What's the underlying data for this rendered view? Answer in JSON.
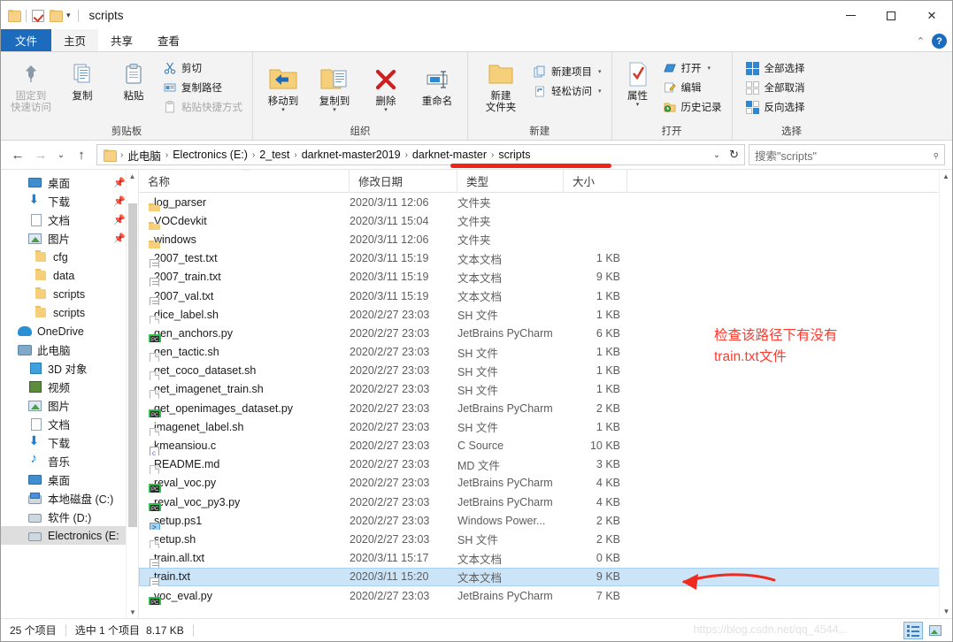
{
  "window": {
    "title": "scripts",
    "controls": {
      "minimize": "—",
      "maximize": "□",
      "close": "✕",
      "collapse_ribbon": "⌃",
      "help": "?"
    }
  },
  "ribbon": {
    "tabs": [
      {
        "id": "file",
        "label": "文件"
      },
      {
        "id": "home",
        "label": "主页"
      },
      {
        "id": "share",
        "label": "共享"
      },
      {
        "id": "view",
        "label": "查看"
      }
    ],
    "groups": [
      {
        "id": "clipboard",
        "label": "剪贴板",
        "big": [
          {
            "id": "pin-to-quick-access",
            "label": "固定到\n快速访问",
            "line1": "固定到",
            "line2": "快速访问",
            "icon": "pin-icon",
            "disabled": true
          },
          {
            "id": "copy",
            "label": "复制",
            "icon": "copy-icon"
          },
          {
            "id": "paste",
            "label": "粘贴",
            "icon": "paste-icon"
          }
        ],
        "small": [
          {
            "id": "cut",
            "label": "剪切",
            "icon": "scissors-icon"
          },
          {
            "id": "copy-path",
            "label": "复制路径",
            "icon": "copy-path-icon"
          },
          {
            "id": "paste-shortcut",
            "label": "粘贴快捷方式",
            "icon": "paste-shortcut-icon",
            "disabled": true
          }
        ]
      },
      {
        "id": "organize",
        "label": "组织",
        "big": [
          {
            "id": "move-to",
            "label": "移动到",
            "icon": "move-to-icon",
            "has_caret": true
          },
          {
            "id": "copy-to",
            "label": "复制到",
            "icon": "copy-to-icon",
            "has_caret": true
          },
          {
            "id": "delete",
            "label": "删除",
            "icon": "delete-icon",
            "has_caret": true
          },
          {
            "id": "rename",
            "label": "重命名",
            "icon": "rename-icon"
          }
        ],
        "small": []
      },
      {
        "id": "new",
        "label": "新建",
        "big": [
          {
            "id": "new-folder",
            "label": "新建\n文件夹",
            "line1": "新建",
            "line2": "文件夹",
            "icon": "new-folder-icon"
          }
        ],
        "small": [
          {
            "id": "new-item",
            "label": "新建项目",
            "icon": "new-item-icon",
            "has_caret": true
          },
          {
            "id": "easy-access",
            "label": "轻松访问",
            "icon": "easy-access-icon",
            "has_caret": true
          }
        ]
      },
      {
        "id": "open",
        "label": "打开",
        "big": [
          {
            "id": "properties",
            "label": "属性",
            "icon": "properties-icon",
            "has_caret": true
          }
        ],
        "small": [
          {
            "id": "open",
            "label": "打开",
            "icon": "open-icon",
            "has_caret": true
          },
          {
            "id": "edit",
            "label": "编辑",
            "icon": "edit-icon"
          },
          {
            "id": "history",
            "label": "历史记录",
            "icon": "history-icon"
          }
        ]
      },
      {
        "id": "select",
        "label": "选择",
        "big": [],
        "small": [
          {
            "id": "select-all",
            "label": "全部选择",
            "icon": "select-all-icon"
          },
          {
            "id": "select-none",
            "label": "全部取消",
            "icon": "select-none-icon"
          },
          {
            "id": "invert-selection",
            "label": "反向选择",
            "icon": "invert-selection-icon"
          }
        ]
      }
    ]
  },
  "navigation": {
    "back": "←",
    "forward": "→",
    "recent": "⌄",
    "up": "↑",
    "breadcrumbs": [
      "此电脑",
      "Electronics (E:)",
      "2_test",
      "darknet-master2019",
      "darknet-master",
      "scripts"
    ],
    "separator": "›",
    "dropdown": "⌄",
    "refresh": "↻",
    "search_placeholder": "搜索\"scripts\""
  },
  "sidebar": {
    "items": [
      {
        "label": "桌面",
        "icon": "desktop-icon",
        "level": 2,
        "pinned": true
      },
      {
        "label": "下载",
        "icon": "download-icon",
        "level": 2,
        "pinned": true
      },
      {
        "label": "文档",
        "icon": "documents-icon",
        "level": 2,
        "pinned": true
      },
      {
        "label": "图片",
        "icon": "pictures-icon",
        "level": 2,
        "pinned": true
      },
      {
        "label": "cfg",
        "icon": "folder-icon",
        "level": 3,
        "pinned": false
      },
      {
        "label": "data",
        "icon": "folder-icon",
        "level": 3,
        "pinned": false
      },
      {
        "label": "scripts",
        "icon": "folder-icon",
        "level": 3,
        "pinned": false
      },
      {
        "label": "scripts",
        "icon": "folder-icon",
        "level": 3,
        "pinned": false
      },
      {
        "label": "OneDrive",
        "icon": "onedrive-icon",
        "level": 1,
        "pinned": false
      },
      {
        "label": "此电脑",
        "icon": "this-pc-icon",
        "level": 1,
        "pinned": false
      },
      {
        "label": "3D 对象",
        "icon": "3d-objects-icon",
        "level": 2,
        "pinned": false
      },
      {
        "label": "视频",
        "icon": "videos-icon",
        "level": 2,
        "pinned": false
      },
      {
        "label": "图片",
        "icon": "pictures-icon",
        "level": 2,
        "pinned": false
      },
      {
        "label": "文档",
        "icon": "documents-icon",
        "level": 2,
        "pinned": false
      },
      {
        "label": "下载",
        "icon": "download-icon",
        "level": 2,
        "pinned": false
      },
      {
        "label": "音乐",
        "icon": "music-icon",
        "level": 2,
        "pinned": false
      },
      {
        "label": "桌面",
        "icon": "desktop-icon",
        "level": 2,
        "pinned": false
      },
      {
        "label": "本地磁盘 (C:)",
        "icon": "system-drive-icon",
        "level": 2,
        "pinned": false
      },
      {
        "label": "软件 (D:)",
        "icon": "drive-icon",
        "level": 2,
        "pinned": false
      },
      {
        "label": "Electronics (E:",
        "icon": "drive-icon",
        "level": 2,
        "pinned": false,
        "selected": true
      }
    ]
  },
  "file_list": {
    "columns": [
      {
        "id": "name",
        "label": "名称",
        "sorted": true
      },
      {
        "id": "date",
        "label": "修改日期",
        "sorted": false
      },
      {
        "id": "type",
        "label": "类型",
        "sorted": false
      },
      {
        "id": "size",
        "label": "大小",
        "sorted": false
      }
    ],
    "rows": [
      {
        "name": "log_parser",
        "date": "2020/3/11 12:06",
        "type": "文件夹",
        "size": "",
        "icon": "folder-icon"
      },
      {
        "name": "VOCdevkit",
        "date": "2020/3/11 15:04",
        "type": "文件夹",
        "size": "",
        "icon": "folder-icon"
      },
      {
        "name": "windows",
        "date": "2020/3/11 12:06",
        "type": "文件夹",
        "size": "",
        "icon": "folder-icon"
      },
      {
        "name": "2007_test.txt",
        "date": "2020/3/11 15:19",
        "type": "文本文档",
        "size": "1 KB",
        "icon": "text-file-icon"
      },
      {
        "name": "2007_train.txt",
        "date": "2020/3/11 15:19",
        "type": "文本文档",
        "size": "9 KB",
        "icon": "text-file-icon"
      },
      {
        "name": "2007_val.txt",
        "date": "2020/3/11 15:19",
        "type": "文本文档",
        "size": "1 KB",
        "icon": "text-file-icon"
      },
      {
        "name": "dice_label.sh",
        "date": "2020/2/27 23:03",
        "type": "SH 文件",
        "size": "1 KB",
        "icon": "blank-file-icon"
      },
      {
        "name": "gen_anchors.py",
        "date": "2020/2/27 23:03",
        "type": "JetBrains PyCharm",
        "size": "6 KB",
        "icon": "pycharm-icon"
      },
      {
        "name": "gen_tactic.sh",
        "date": "2020/2/27 23:03",
        "type": "SH 文件",
        "size": "1 KB",
        "icon": "blank-file-icon"
      },
      {
        "name": "get_coco_dataset.sh",
        "date": "2020/2/27 23:03",
        "type": "SH 文件",
        "size": "1 KB",
        "icon": "blank-file-icon"
      },
      {
        "name": "get_imagenet_train.sh",
        "date": "2020/2/27 23:03",
        "type": "SH 文件",
        "size": "1 KB",
        "icon": "blank-file-icon"
      },
      {
        "name": "get_openimages_dataset.py",
        "date": "2020/2/27 23:03",
        "type": "JetBrains PyCharm",
        "size": "2 KB",
        "icon": "pycharm-icon"
      },
      {
        "name": "imagenet_label.sh",
        "date": "2020/2/27 23:03",
        "type": "SH 文件",
        "size": "1 KB",
        "icon": "blank-file-icon"
      },
      {
        "name": "kmeansiou.c",
        "date": "2020/2/27 23:03",
        "type": "C Source",
        "size": "10 KB",
        "icon": "c-source-icon"
      },
      {
        "name": "README.md",
        "date": "2020/2/27 23:03",
        "type": "MD 文件",
        "size": "3 KB",
        "icon": "blank-file-icon"
      },
      {
        "name": "reval_voc.py",
        "date": "2020/2/27 23:03",
        "type": "JetBrains PyCharm",
        "size": "4 KB",
        "icon": "pycharm-icon"
      },
      {
        "name": "reval_voc_py3.py",
        "date": "2020/2/27 23:03",
        "type": "JetBrains PyCharm",
        "size": "4 KB",
        "icon": "pycharm-icon"
      },
      {
        "name": "setup.ps1",
        "date": "2020/2/27 23:03",
        "type": "Windows Power...",
        "size": "2 KB",
        "icon": "powershell-icon"
      },
      {
        "name": "setup.sh",
        "date": "2020/2/27 23:03",
        "type": "SH 文件",
        "size": "2 KB",
        "icon": "blank-file-icon"
      },
      {
        "name": "train.all.txt",
        "date": "2020/3/11 15:17",
        "type": "文本文档",
        "size": "0 KB",
        "icon": "text-file-icon"
      },
      {
        "name": "train.txt",
        "date": "2020/3/11 15:20",
        "type": "文本文档",
        "size": "9 KB",
        "icon": "text-file-icon",
        "selected": true
      },
      {
        "name": "voc_eval.py",
        "date": "2020/2/27 23:03",
        "type": "JetBrains PyCharm",
        "size": "7 KB",
        "icon": "pycharm-icon"
      }
    ]
  },
  "status_bar": {
    "item_count": "25 个项目",
    "selection": "选中 1 个项目",
    "selection_size": "8.17 KB",
    "views": [
      {
        "id": "details-view",
        "icon": "details-view-icon",
        "active": true
      },
      {
        "id": "thumbnail-view",
        "icon": "thumbnail-view-icon",
        "active": false
      }
    ]
  },
  "annotations": {
    "note_line1": "检查该路径下有没有",
    "note_line2": "train.txt文件",
    "color": "#ff3b30",
    "watermark": "https://blog.csdn.net/qq_4544..."
  }
}
